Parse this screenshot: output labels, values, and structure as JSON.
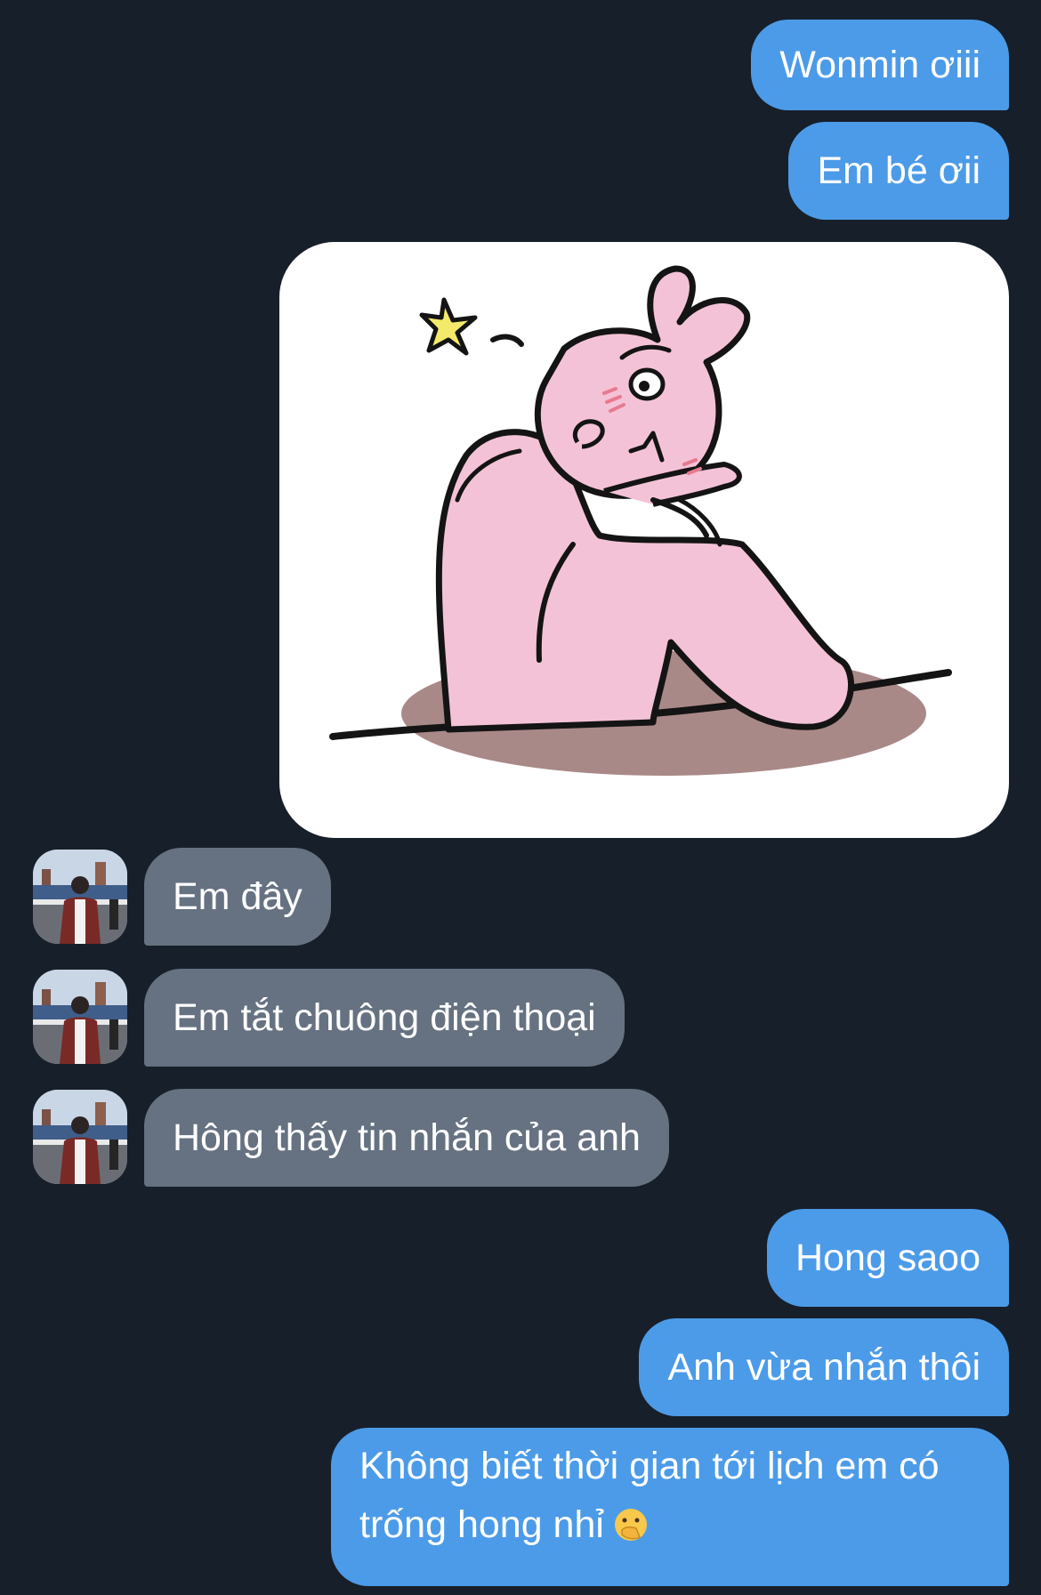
{
  "messages": {
    "m1": "Wonmin ơiii",
    "m2": "Em bé ơii",
    "m3": "Em đây",
    "m4": "Em tắt chuông điện thoại",
    "m5": "Hông thấy tin nhắn của anh",
    "m6": "Hong saoo",
    "m7": "Anh vừa nhắn thôi",
    "m8_line1": "Không biết thời gian tới lịch em có",
    "m8_line2": "trống hong nhỉ"
  },
  "icons": {
    "sticker": "bunny-thinking-sticker",
    "emoji": "face-with-hand-over-mouth-icon",
    "avatar": "contact-avatar"
  },
  "colors": {
    "background": "#171f2a",
    "sent_bubble": "#4c9be8",
    "received_bubble": "#667281"
  }
}
